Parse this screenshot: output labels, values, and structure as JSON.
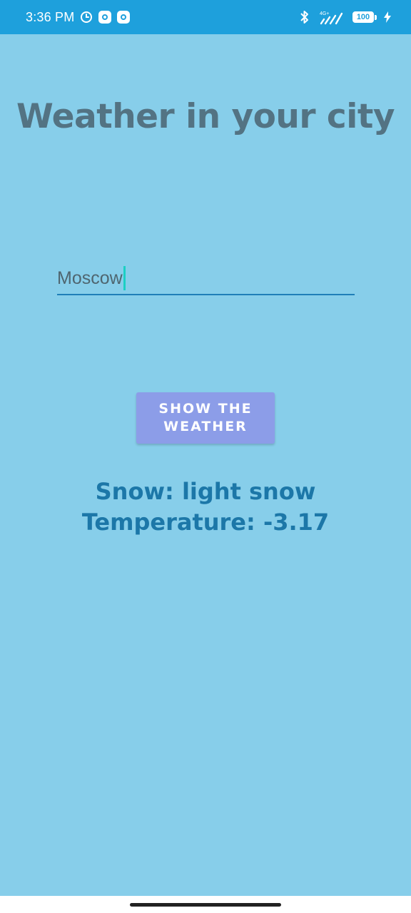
{
  "status_bar": {
    "time": "3:36 PM",
    "network": "4G+",
    "battery": "100",
    "icons": [
      "alarm-icon",
      "app-notification-icon",
      "app-notification-icon",
      "bluetooth-icon",
      "signal-icon",
      "battery-icon",
      "charging-icon"
    ]
  },
  "main": {
    "title": "Weather in your city",
    "city_input": {
      "value": "Moscow"
    },
    "show_button": {
      "label": "SHOW THE WEATHER"
    },
    "result": {
      "line1": "Snow: light snow",
      "line2": "Temperature: -3.17"
    }
  },
  "colors": {
    "background": "#87ceea",
    "status_bar": "#1ea0dc",
    "title": "#537383",
    "button": "#8c9de8",
    "result_text": "#1c77a8",
    "input_underline": "#1f7fb8",
    "caret": "#1ccfc4"
  }
}
